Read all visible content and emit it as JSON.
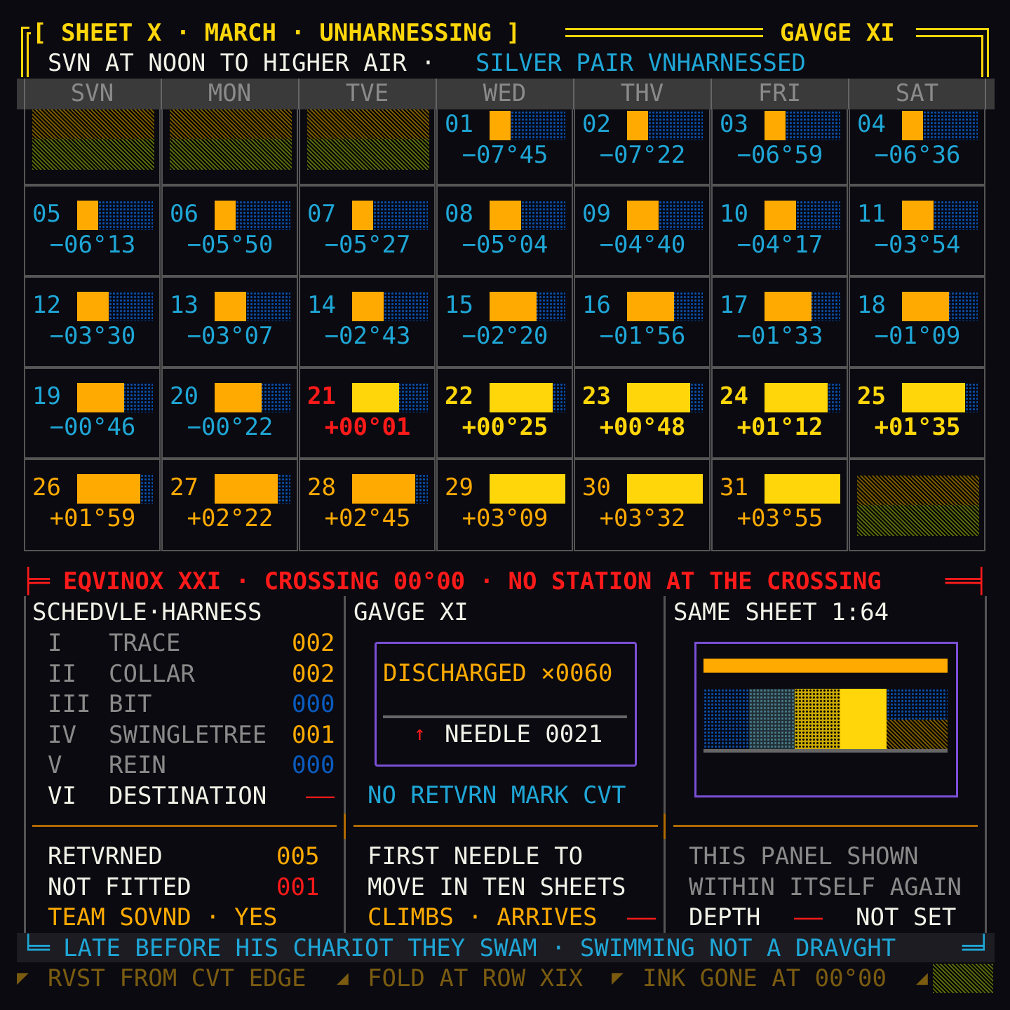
{
  "header": {
    "left": "[ SHEET X · MARCH · UNHARNESSING ]",
    "right": "GAVGE XI",
    "sub_white": "SVN AT NOON TO HIGHER AIR ·",
    "sub_cyan": "SILVER PAIR VNHARNESSED"
  },
  "weekdays": [
    "SVN",
    "MON",
    "TVE",
    "WED",
    "THV",
    "FRI",
    "SAT"
  ],
  "days": [
    {
      "n": "01",
      "decl": "−07°45",
      "fill": 0.28,
      "tone": "neg"
    },
    {
      "n": "02",
      "decl": "−07°22",
      "fill": 0.28,
      "tone": "neg"
    },
    {
      "n": "03",
      "decl": "−06°59",
      "fill": 0.28,
      "tone": "neg"
    },
    {
      "n": "04",
      "decl": "−06°36",
      "fill": 0.28,
      "tone": "neg"
    },
    {
      "n": "05",
      "decl": "−06°13",
      "fill": 0.28,
      "tone": "neg"
    },
    {
      "n": "06",
      "decl": "−05°50",
      "fill": 0.28,
      "tone": "neg"
    },
    {
      "n": "07",
      "decl": "−05°27",
      "fill": 0.28,
      "tone": "neg"
    },
    {
      "n": "08",
      "decl": "−05°04",
      "fill": 0.42,
      "tone": "neg"
    },
    {
      "n": "09",
      "decl": "−04°40",
      "fill": 0.42,
      "tone": "neg"
    },
    {
      "n": "10",
      "decl": "−04°17",
      "fill": 0.42,
      "tone": "neg"
    },
    {
      "n": "11",
      "decl": "−03°54",
      "fill": 0.42,
      "tone": "neg"
    },
    {
      "n": "12",
      "decl": "−03°30",
      "fill": 0.42,
      "tone": "neg"
    },
    {
      "n": "13",
      "decl": "−03°07",
      "fill": 0.42,
      "tone": "neg"
    },
    {
      "n": "14",
      "decl": "−02°43",
      "fill": 0.42,
      "tone": "neg"
    },
    {
      "n": "15",
      "decl": "−02°20",
      "fill": 0.62,
      "tone": "neg"
    },
    {
      "n": "16",
      "decl": "−01°56",
      "fill": 0.62,
      "tone": "neg"
    },
    {
      "n": "17",
      "decl": "−01°33",
      "fill": 0.62,
      "tone": "neg"
    },
    {
      "n": "18",
      "decl": "−01°09",
      "fill": 0.62,
      "tone": "neg"
    },
    {
      "n": "19",
      "decl": "−00°46",
      "fill": 0.62,
      "tone": "neg"
    },
    {
      "n": "20",
      "decl": "−00°22",
      "fill": 0.62,
      "tone": "neg"
    },
    {
      "n": "21",
      "decl": "+00°01",
      "fill": 0.62,
      "tone": "equinox"
    },
    {
      "n": "22",
      "decl": "+00°25",
      "fill": 0.83,
      "tone": "pos"
    },
    {
      "n": "23",
      "decl": "+00°48",
      "fill": 0.83,
      "tone": "pos"
    },
    {
      "n": "24",
      "decl": "+01°12",
      "fill": 0.83,
      "tone": "pos"
    },
    {
      "n": "25",
      "decl": "+01°35",
      "fill": 0.83,
      "tone": "pos"
    },
    {
      "n": "26",
      "decl": "+01°59",
      "fill": 0.83,
      "tone": "late"
    },
    {
      "n": "27",
      "decl": "+02°22",
      "fill": 0.83,
      "tone": "late"
    },
    {
      "n": "28",
      "decl": "+02°45",
      "fill": 0.83,
      "tone": "late"
    },
    {
      "n": "29",
      "decl": "+03°09",
      "fill": 1.0,
      "tone": "full"
    },
    {
      "n": "30",
      "decl": "+03°32",
      "fill": 1.0,
      "tone": "full"
    },
    {
      "n": "31",
      "decl": "+03°55",
      "fill": 1.0,
      "tone": "full"
    }
  ],
  "equinox_banner": "EQVINOX XXI · CROSSING 00°00 · NO STATION AT THE CROSSING",
  "schedule": {
    "title": "SCHEDVLE·HARNESS",
    "rows": [
      {
        "num": "I",
        "name": "TRACE",
        "val": "002",
        "tone": "o"
      },
      {
        "num": "II",
        "name": "COLLAR",
        "val": "002",
        "tone": "o"
      },
      {
        "num": "III",
        "name": "BIT",
        "val": "000",
        "tone": "b"
      },
      {
        "num": "IV",
        "name": "SWINGLETREE",
        "val": "001",
        "tone": "o"
      },
      {
        "num": "V",
        "name": "REIN",
        "val": "000",
        "tone": "b"
      },
      {
        "num": "VI",
        "name": "DESTINATION",
        "val": "——",
        "tone": "r"
      }
    ],
    "returned_label": "RETVRNED",
    "returned_val": "005",
    "not_fitted_label": "NOT FITTED",
    "not_fitted_val": "001",
    "team": "TEAM SOVND · YES"
  },
  "gauge": {
    "title": "GAVGE XI",
    "discharged": "DISCHARGED ×0060",
    "needle_arrow": "↑",
    "needle": "NEEDLE 0021",
    "no_return": "NO RETVRN MARK CVT",
    "line1": "FIRST NEEDLE TO",
    "line2": "MOVE IN TEN SHEETS",
    "climbs": "CLIMBS · ARRIVES",
    "climbs_dash": "——"
  },
  "same_sheet": {
    "title": "SAME SHEET 1:64",
    "line1": "THIS PANEL SHOWN",
    "line2": "WITHIN ITSELF AGAIN",
    "depth": "DEPTH",
    "depth_dash": "——",
    "not_set": "NOT SET"
  },
  "footer_banner": "LATE BEFORE HIS CHARIOT THEY SWAM · SWIMMING NOT A DRAVGHT",
  "bottom": {
    "a": "RVST FROM CVT EDGE",
    "b": "FOLD AT ROW XIX",
    "c": "INK GONE AT 00°00"
  },
  "colors": {
    "accent": "#ffd60a",
    "orange": "#ffaa00",
    "cyan": "#1fa6d6",
    "red": "#ff1a1a",
    "violet": "#7b4fd6"
  }
}
